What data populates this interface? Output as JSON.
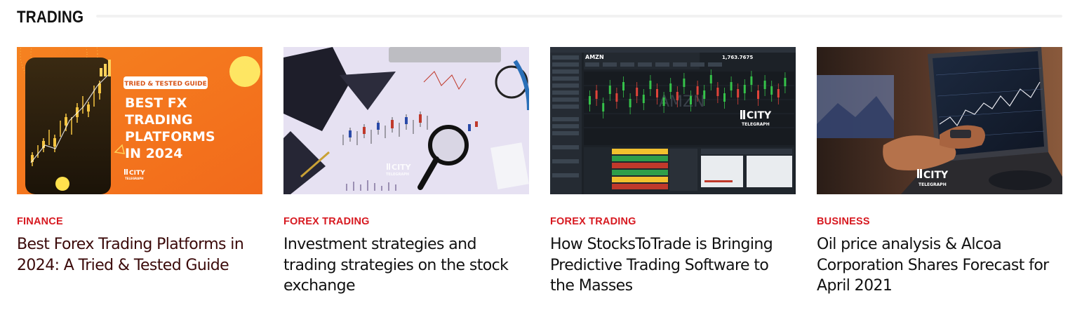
{
  "section": {
    "title": "TRADING"
  },
  "colors": {
    "accent": "#d71920",
    "rule": "#f2f2f2",
    "orange": "#f47a1f"
  },
  "cards": [
    {
      "category": "FINANCE",
      "headline": "Best Forex Trading Platforms in 2024: A Tried & Tested Guide",
      "thumb": {
        "badge": "TRIED & TESTED GUIDE",
        "line1": "BEST FX",
        "line2": "TRADING",
        "line3": "PLATFORMS",
        "line4": "IN 2024",
        "logo_top": "CITY",
        "logo_bottom": "TELEGRAPH"
      }
    },
    {
      "category": "FOREX TRADING",
      "headline": "Investment strategies and trading strategies on the stock exchange",
      "thumb": {
        "logo_top": "CITY",
        "logo_bottom": "TELEGRAPH"
      }
    },
    {
      "category": "FOREX TRADING",
      "headline": "How StocksToTrade is Bringing Predictive Trading Software to the Masses",
      "thumb": {
        "ticker": "AMZN",
        "price": "1,763.7675",
        "logo_top": "CITY",
        "logo_bottom": "TELEGRAPH"
      }
    },
    {
      "category": "BUSINESS",
      "headline": "Oil price analysis & Alcoa Corporation Shares Forecast for April 2021",
      "thumb": {
        "logo_top": "CITY",
        "logo_bottom": "TELEGRAPH"
      }
    }
  ]
}
